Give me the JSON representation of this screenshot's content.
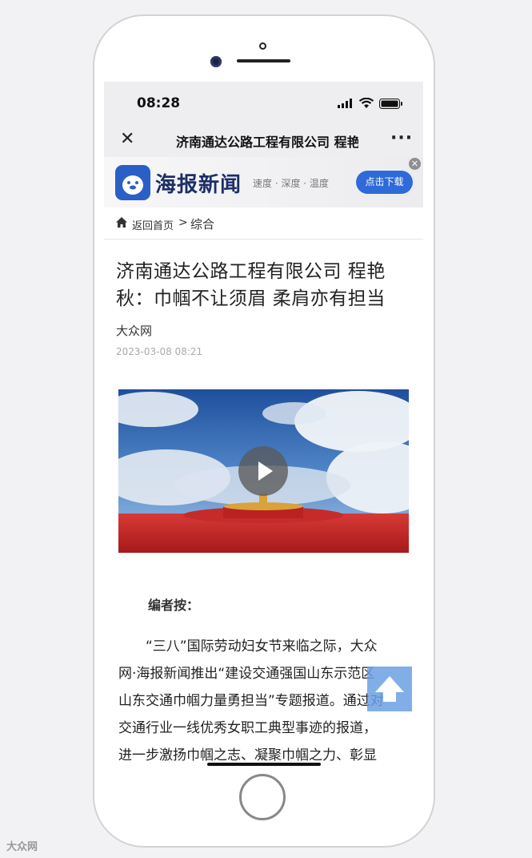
{
  "status_bar": {
    "time": "08:28"
  },
  "nav": {
    "title": "济南通达公路工程有限公司 程艳秋：巾帼不让须眉 柔肩亦有担当"
  },
  "banner": {
    "app_name": "海报新闻",
    "slogan": "速度 · 深度 · 温度",
    "download_label": "点击下载"
  },
  "breadcrumb": {
    "back_label": "返回首页",
    "separator": ">",
    "category": "综合"
  },
  "article": {
    "title": "济南通达公路工程有限公司 程艳秋：巾帼不让须眉 柔肩亦有担当",
    "source": "大众网",
    "date": "2023-03-08 08:21",
    "editor_note_label": "编者按：",
    "body_lines": [
      "“三八”国际劳动妇女节来临之际，大众",
      "网·海报新闻推出“建设交通强国山东示范区",
      "山东交通巾帼力量勇担当”专题报道。通过对",
      "交通行业一线优秀女职工典型事迹的报道，",
      "进一步激扬巾帼之志、凝聚巾帼之力、彰显"
    ]
  },
  "watermark": "大众网"
}
